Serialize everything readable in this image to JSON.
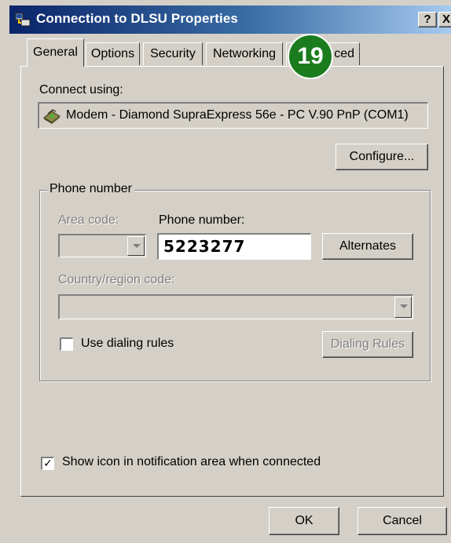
{
  "window": {
    "title": "Connection to DLSU Properties",
    "help_button": "?",
    "close_button": "X"
  },
  "tabs": [
    {
      "label": "General",
      "active": true
    },
    {
      "label": "Options",
      "active": false
    },
    {
      "label": "Security",
      "active": false
    },
    {
      "label": "Networking",
      "active": false
    },
    {
      "label": "Advanced",
      "visible_label": "ced",
      "active": false
    }
  ],
  "step_badge": "19",
  "general": {
    "connect_using_label": "Connect using:",
    "modem_name": "Modem - Diamond SupraExpress 56e - PC V.90 PnP (COM1)",
    "configure_button": "Configure...",
    "phone_group": {
      "title": "Phone number",
      "area_code_label": "Area code:",
      "area_code_value": "",
      "phone_number_label": "Phone number:",
      "phone_number_value": "5223277",
      "alternates_button": "Alternates",
      "country_region_label": "Country/region code:",
      "country_region_value": "",
      "use_dialing_rules_label": "Use dialing rules",
      "use_dialing_rules_checked": false,
      "dialing_rules_button": "Dialing Rules"
    },
    "show_icon_label": "Show icon in notification area when connected",
    "show_icon_checked": true
  },
  "footer": {
    "ok_button": "OK",
    "cancel_button": "Cancel"
  },
  "colors": {
    "dialog_face": "#d4d0c8",
    "titlebar_start": "#0a246a",
    "titlebar_end": "#a6caf0",
    "badge": "#1b7c1e"
  }
}
